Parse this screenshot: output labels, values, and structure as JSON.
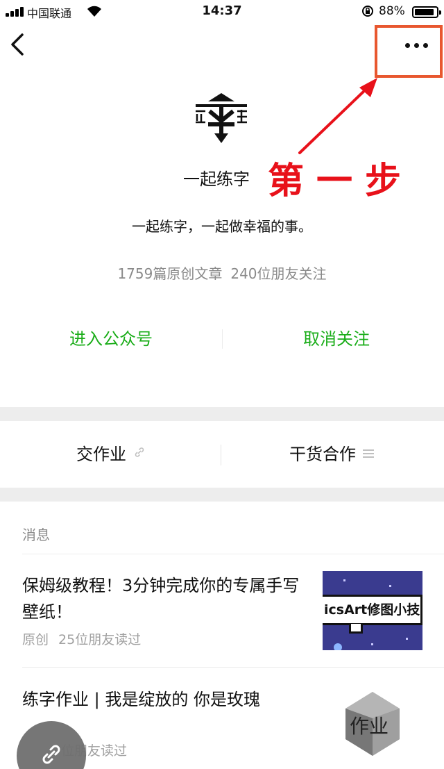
{
  "status_bar": {
    "carrier": "中国联通",
    "time": "14:37",
    "battery_percent": "88%",
    "battery_level": 0.88
  },
  "nav": {
    "back_icon": "chevron-left-icon",
    "more_icon": "more-dots-icon"
  },
  "profile": {
    "name": "一起练字",
    "description": "一起练字，一起做幸福的事。",
    "articles_count": "1759篇原创文章",
    "followers": "240位朋友关注"
  },
  "annotation": {
    "text": "第一步",
    "color": "#e8111a",
    "box_color": "#e8572f"
  },
  "actions": {
    "enter": "进入公众号",
    "unfollow": "取消关注",
    "color": "#1aad19"
  },
  "menu": [
    {
      "label": "交作业",
      "icon": "link-icon"
    },
    {
      "label": "干货合作",
      "icon": "list-icon"
    }
  ],
  "messages": {
    "section_label": "消息",
    "items": [
      {
        "title": "保姆级教程！3分钟完成你的专属手写壁纸！",
        "tag": "原创",
        "reads": "25位朋友读过",
        "thumb_text": "icsArt修图小技"
      },
      {
        "title": "练字作业 | 我是绽放的 你是玫瑰",
        "reads": "位朋友读过",
        "thumb_text": "作业"
      }
    ]
  }
}
